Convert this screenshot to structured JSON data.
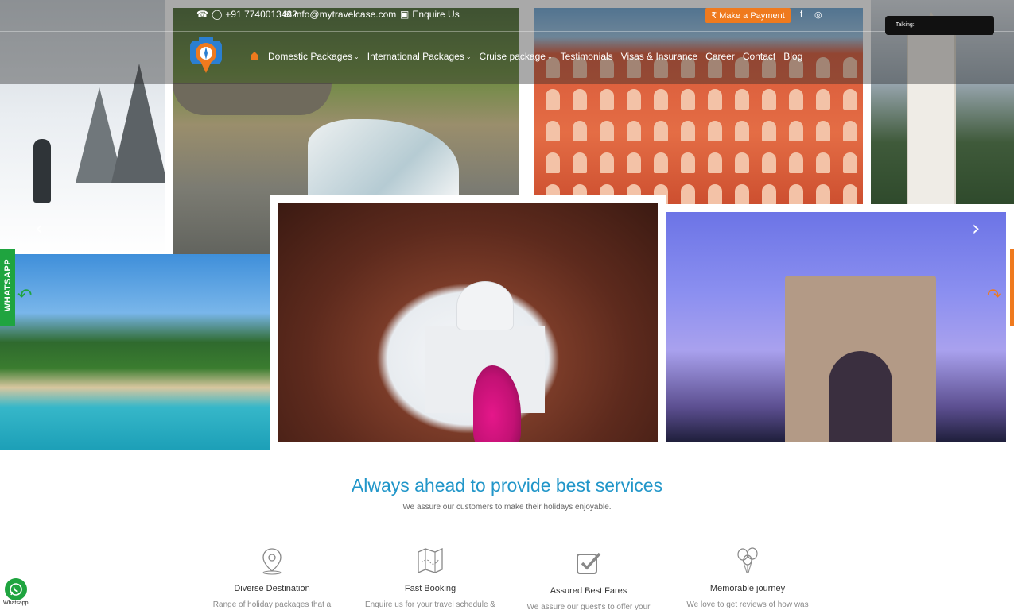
{
  "header": {
    "phone": "+91 7740013482",
    "email": "info@mytravelcase.com",
    "enquire": "Enquire Us",
    "payment_button": "Make a Payment",
    "talk_widget": "Talking:"
  },
  "nav": {
    "items": [
      {
        "label": "Domestic Packages",
        "dropdown": true
      },
      {
        "label": "International Packages",
        "dropdown": true
      },
      {
        "label": "Cruise package",
        "dropdown": true
      },
      {
        "label": "Testimonials",
        "dropdown": false
      },
      {
        "label": "Visas & Insurance",
        "dropdown": false
      },
      {
        "label": "Career",
        "dropdown": false
      },
      {
        "label": "Contact",
        "dropdown": false
      },
      {
        "label": "Blog",
        "dropdown": false
      }
    ]
  },
  "side": {
    "whatsapp_tab": "WHATSAPP",
    "whatsapp_float_label": "Whatsapp"
  },
  "services": {
    "headline": "Always ahead to provide best services",
    "subtitle": "We assure our customers to make their holidays enjoyable.",
    "items": [
      {
        "title": "Diverse Destination",
        "desc": "Range of holiday packages that a",
        "icon": "map-pin-icon"
      },
      {
        "title": "Fast Booking",
        "desc": "Enquire us for your travel schedule &",
        "icon": "map-icon"
      },
      {
        "title": "Assured Best Fares",
        "desc": "We assure our guest's to offer your",
        "icon": "check-square-icon"
      },
      {
        "title": "Memorable journey",
        "desc": "We love to get reviews of how was",
        "icon": "balloons-icon"
      }
    ]
  },
  "colors": {
    "accent": "#ef7a1e",
    "heading": "#2196c9",
    "whatsapp": "#1fa43f"
  }
}
